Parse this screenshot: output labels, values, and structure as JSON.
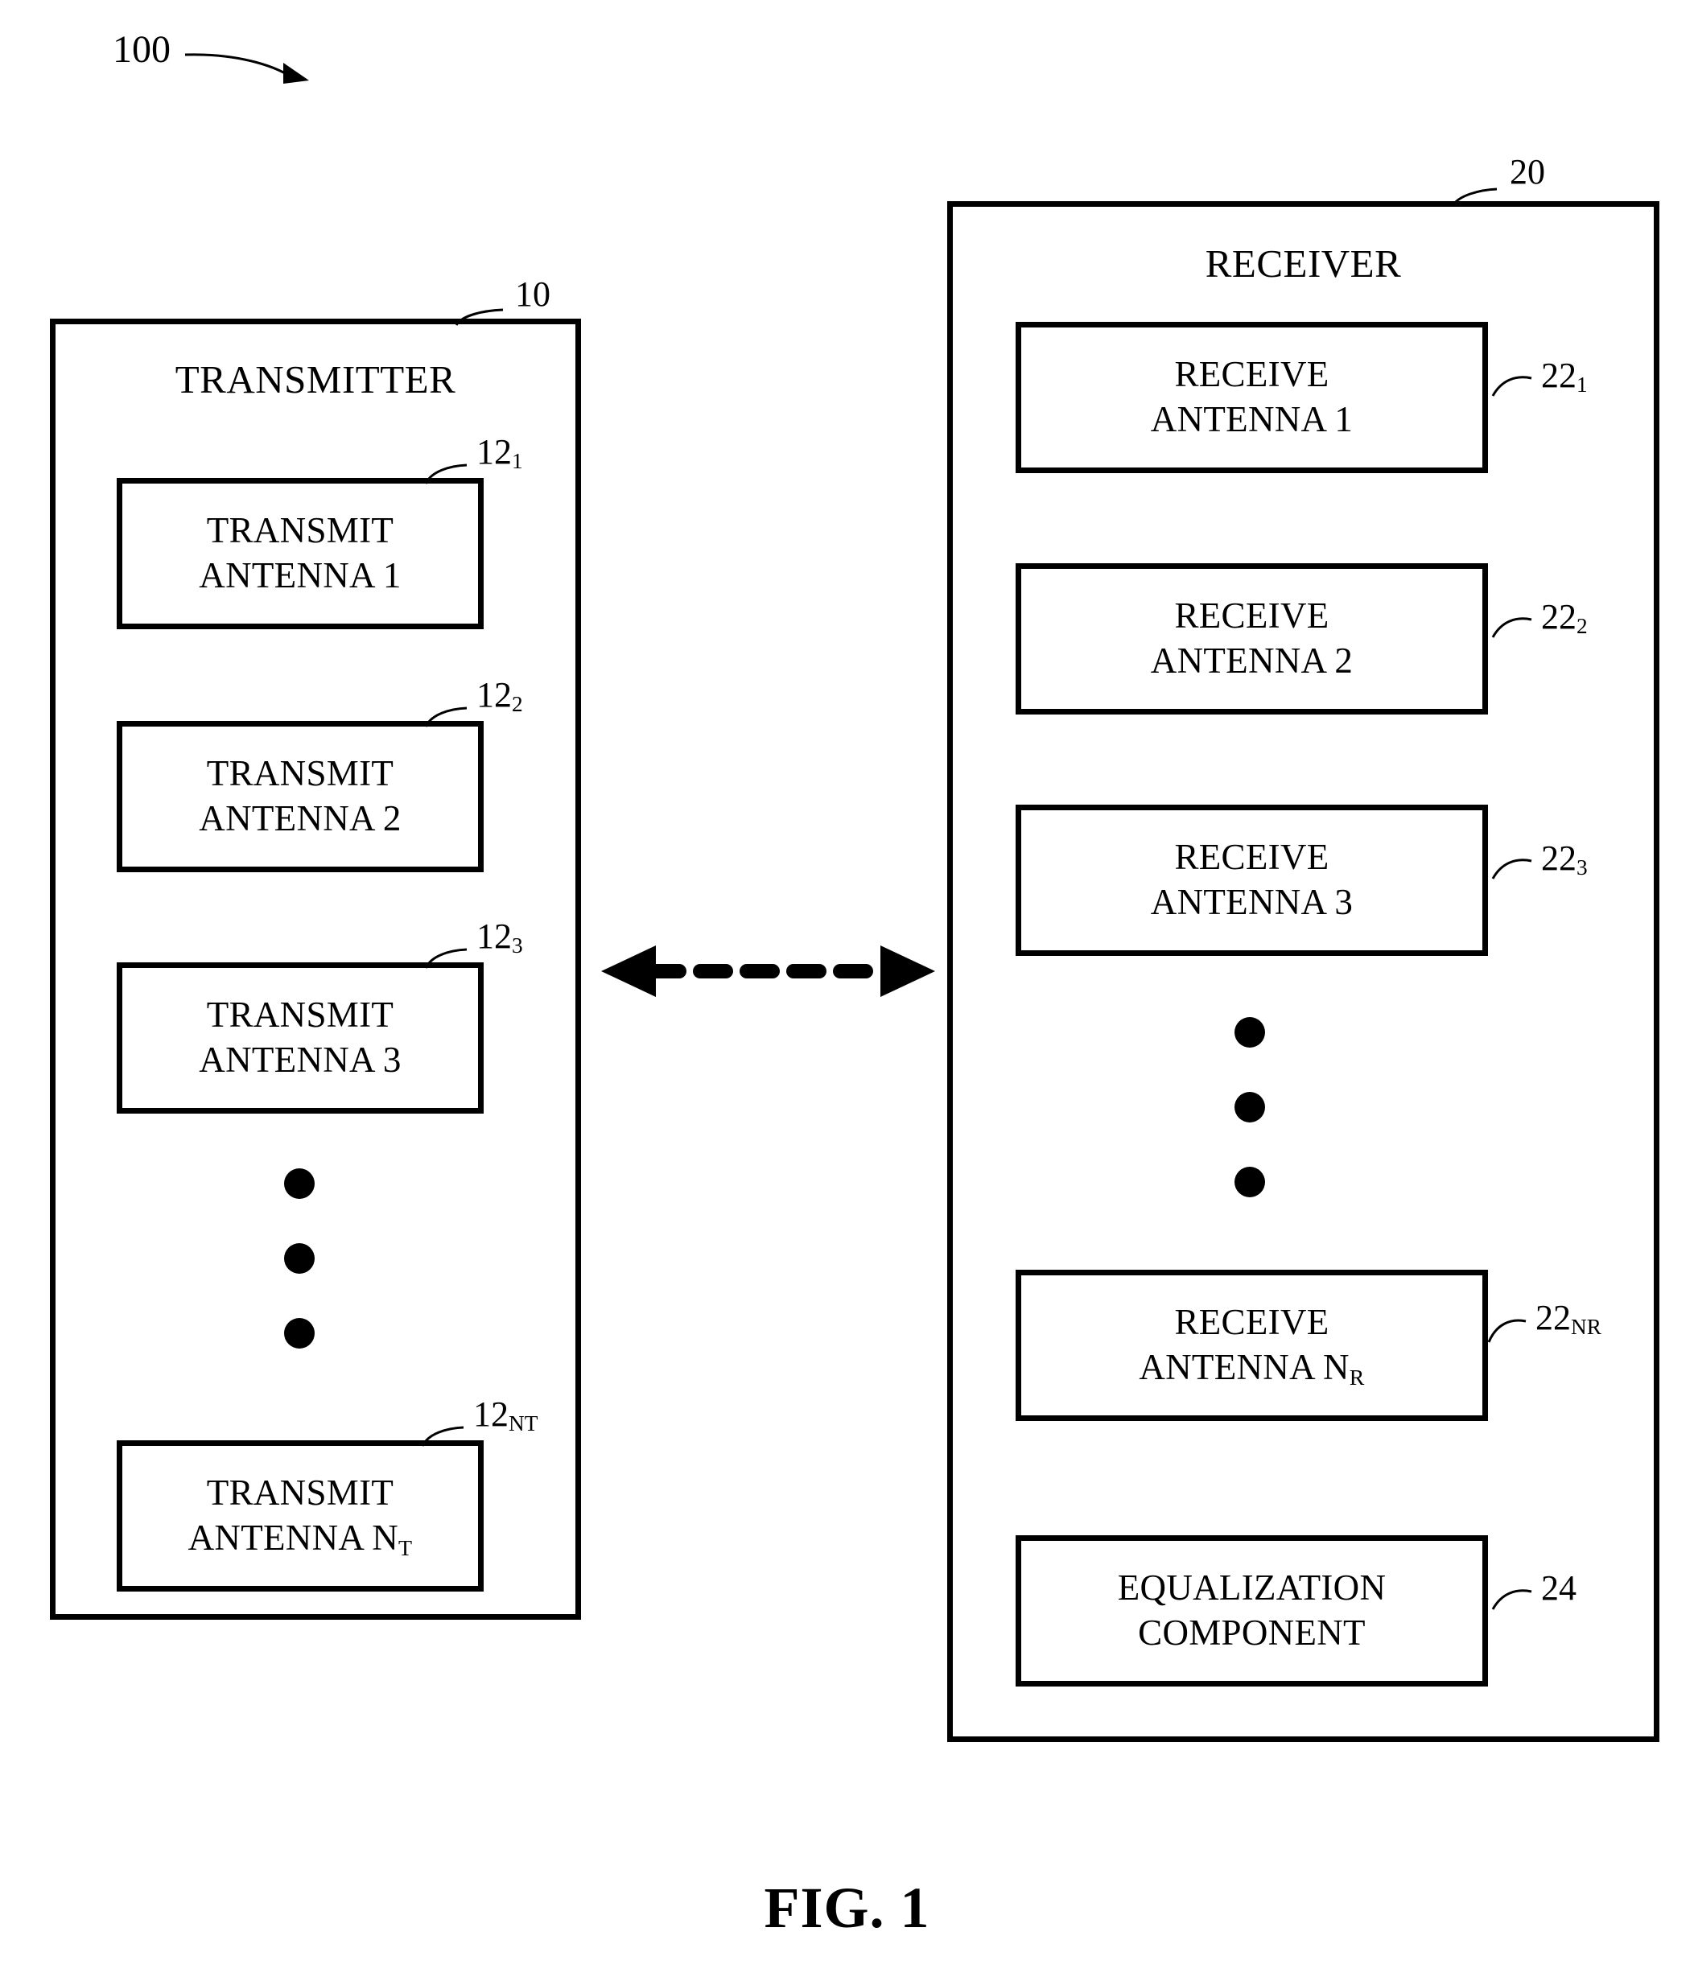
{
  "figure": {
    "caption": "FIG. 1",
    "system_ref": "100"
  },
  "transmitter": {
    "title": "TRANSMITTER",
    "ref": "10",
    "antennas": [
      {
        "line1": "TRANSMIT",
        "line2": "ANTENNA 1",
        "ref_base": "12",
        "ref_sub": "1"
      },
      {
        "line1": "TRANSMIT",
        "line2": "ANTENNA 2",
        "ref_base": "12",
        "ref_sub": "2"
      },
      {
        "line1": "TRANSMIT",
        "line2": "ANTENNA 3",
        "ref_base": "12",
        "ref_sub": "3"
      },
      {
        "line1": "TRANSMIT",
        "line2": "ANTENNA N",
        "line2_sub": "T",
        "ref_base": "12",
        "ref_sub": "NT"
      }
    ]
  },
  "receiver": {
    "title": "RECEIVER",
    "ref": "20",
    "antennas": [
      {
        "line1": "RECEIVE",
        "line2": "ANTENNA 1",
        "ref_base": "22",
        "ref_sub": "1"
      },
      {
        "line1": "RECEIVE",
        "line2": "ANTENNA 2",
        "ref_base": "22",
        "ref_sub": "2"
      },
      {
        "line1": "RECEIVE",
        "line2": "ANTENNA 3",
        "ref_base": "22",
        "ref_sub": "3"
      },
      {
        "line1": "RECEIVE",
        "line2": "ANTENNA N",
        "line2_sub": "R",
        "ref_base": "22",
        "ref_sub": "NR"
      }
    ],
    "equalization": {
      "line1": "EQUALIZATION",
      "line2": "COMPONENT",
      "ref_base": "24",
      "ref_sub": ""
    }
  },
  "link": {
    "style": "dashed-double-arrow",
    "description": "wireless channel between transmitter and receiver"
  },
  "colors": {
    "stroke": "#000000",
    "background": "#ffffff"
  }
}
